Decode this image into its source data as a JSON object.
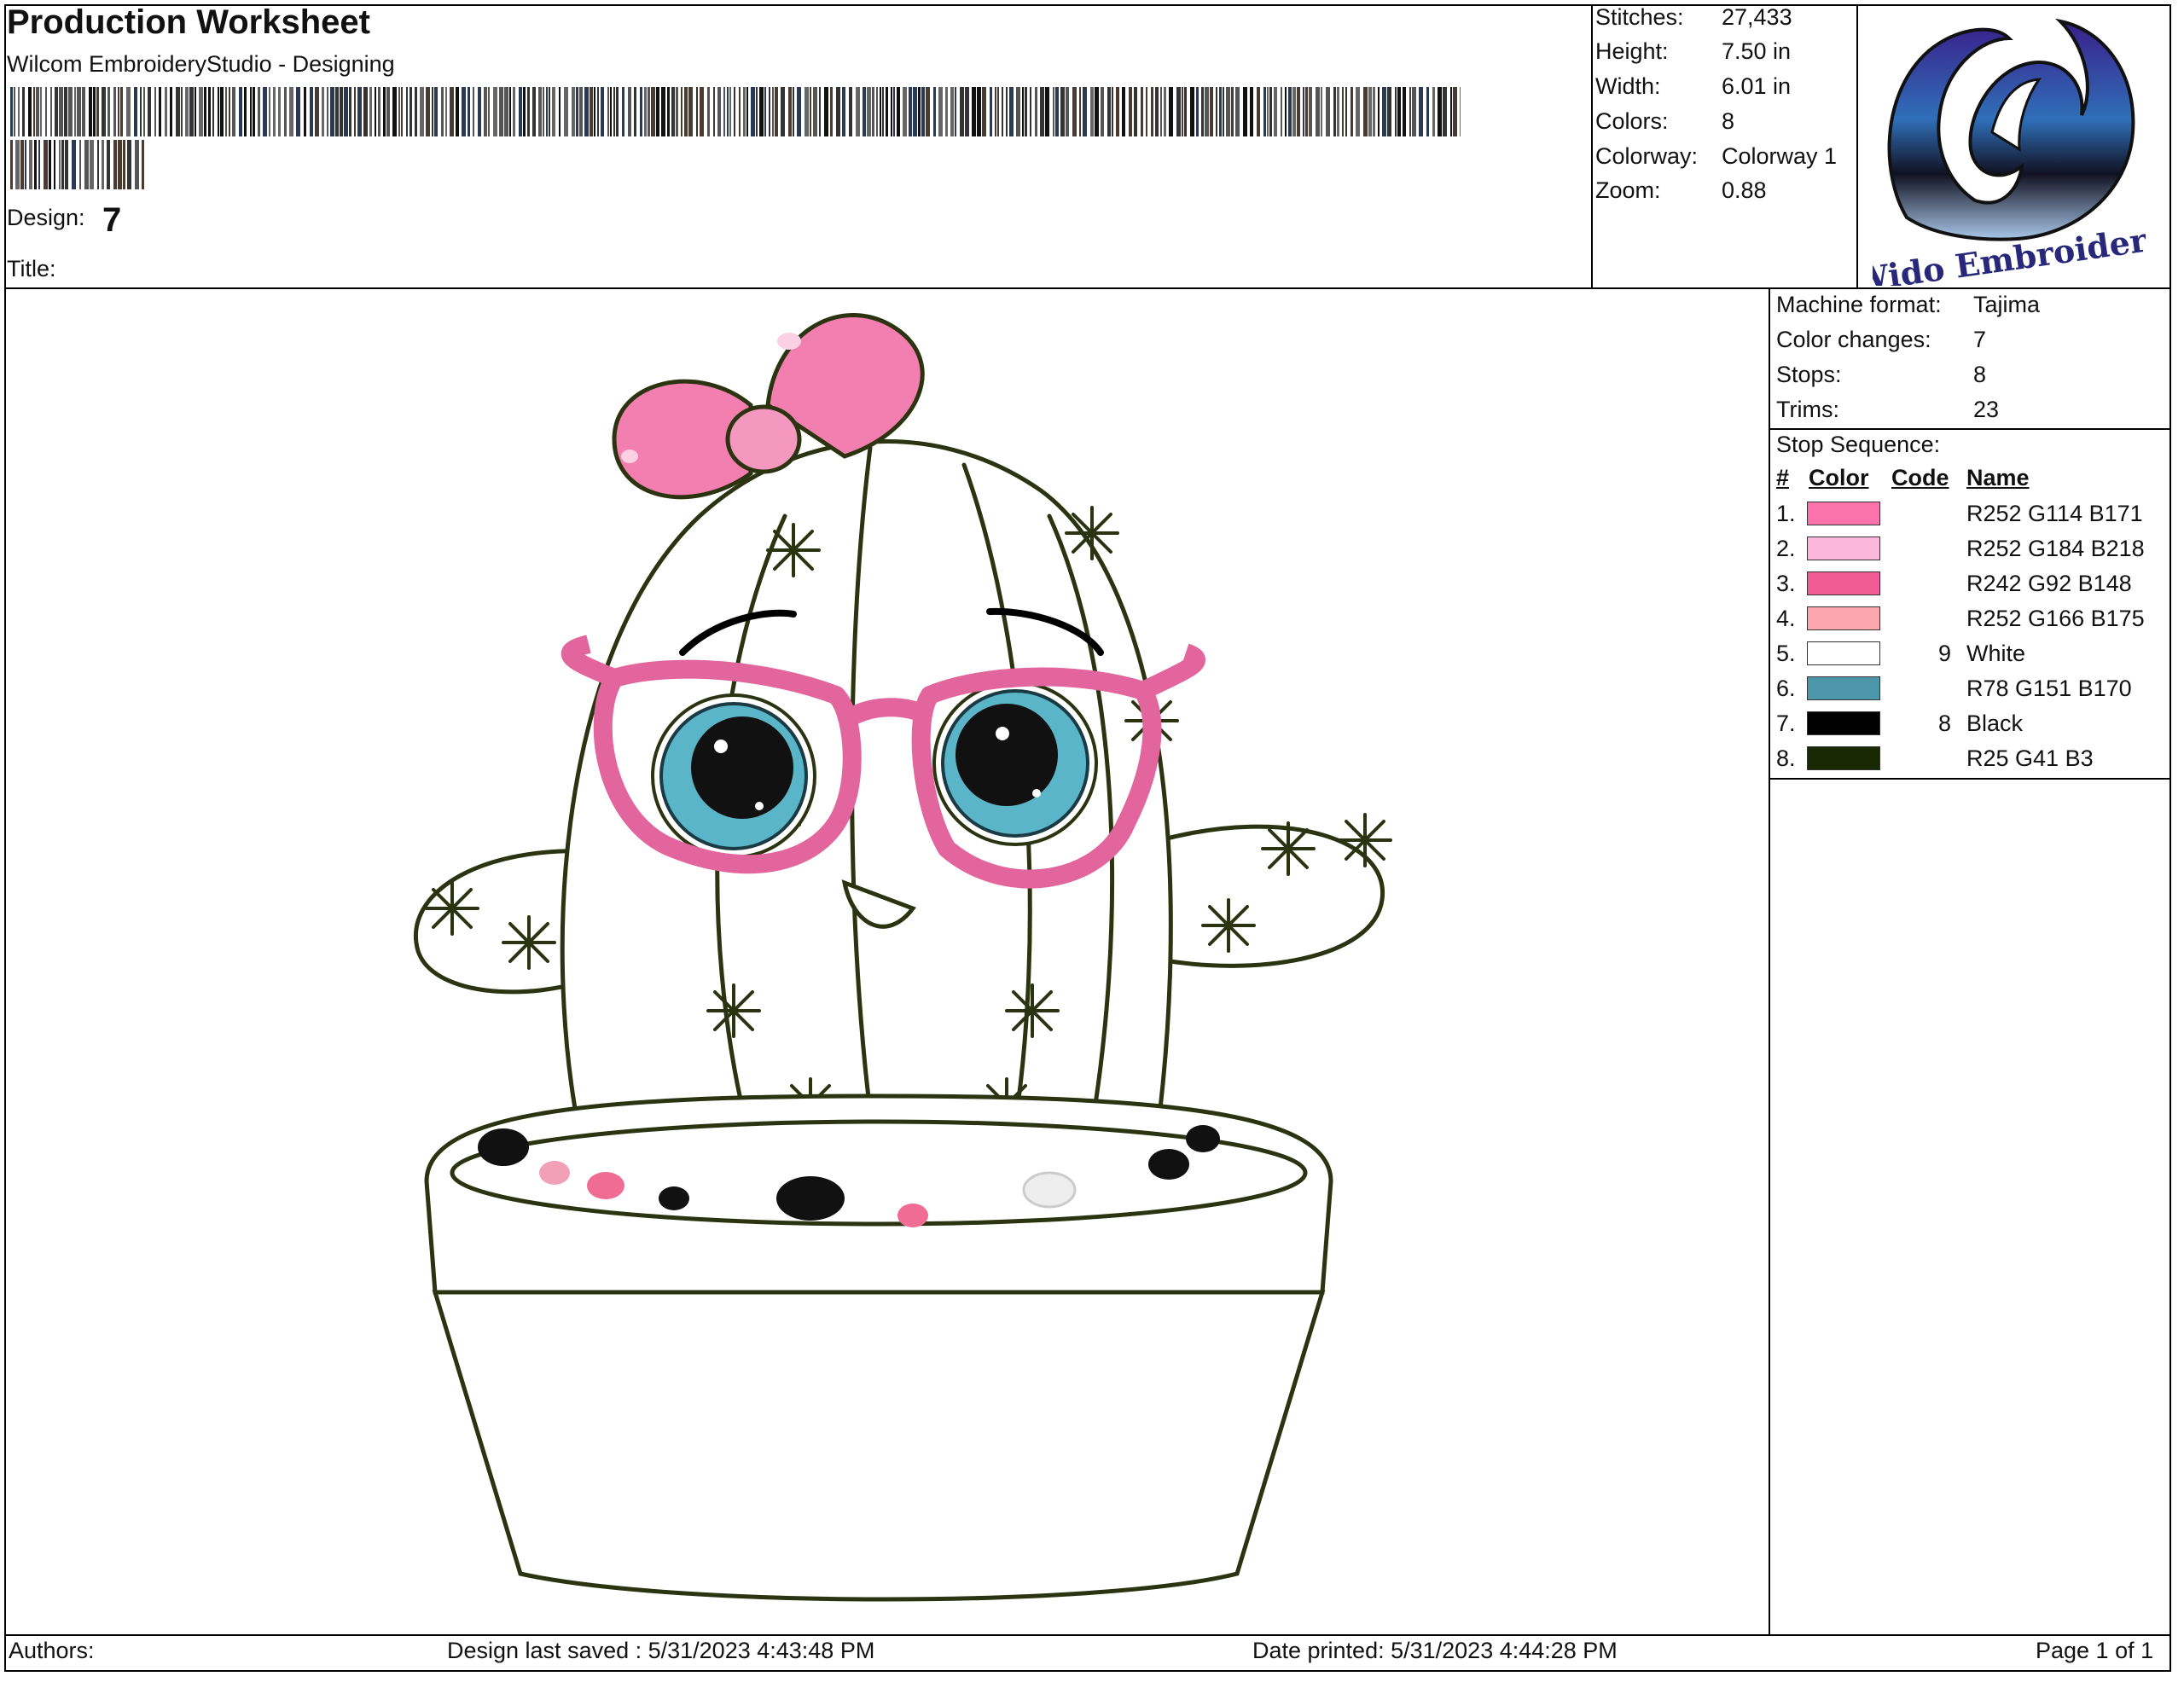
{
  "header": {
    "title": "Production Worksheet",
    "subtitle": "Wilcom EmbroideryStudio - Designing",
    "design_label": "Design:",
    "design_value": "7",
    "title_label": "Title:"
  },
  "stats": [
    {
      "label": "Stitches:",
      "value": "27,433"
    },
    {
      "label": "Height:",
      "value": "7.50 in"
    },
    {
      "label": "Width:",
      "value": "6.01 in"
    },
    {
      "label": "Colors:",
      "value": "8"
    },
    {
      "label": "Colorway:",
      "value": "Colorway 1"
    },
    {
      "label": "Zoom:",
      "value": "0.88"
    }
  ],
  "logo": {
    "text": "Wido Embroidery"
  },
  "machine": [
    {
      "label": "Machine format:",
      "value": "Tajima"
    },
    {
      "label": "Color changes:",
      "value": "7"
    },
    {
      "label": "Stops:",
      "value": "8"
    },
    {
      "label": "Trims:",
      "value": "23"
    }
  ],
  "stop_sequence": {
    "label": "Stop Sequence:",
    "headers": {
      "num": "#",
      "color": "Color",
      "code": "Code",
      "name": "Name"
    },
    "rows": [
      {
        "num": "1.",
        "color": "#fc72ab",
        "code": "",
        "name": "R252 G114 B171"
      },
      {
        "num": "2.",
        "color": "#fcb8da",
        "code": "",
        "name": "R252 G184 B218"
      },
      {
        "num": "3.",
        "color": "#f25c94",
        "code": "",
        "name": "R242 G92 B148"
      },
      {
        "num": "4.",
        "color": "#fca6af",
        "code": "",
        "name": "R252 G166 B175"
      },
      {
        "num": "5.",
        "color": "#ffffff",
        "code": "9",
        "name": "White"
      },
      {
        "num": "6.",
        "color": "#4e97aa",
        "code": "",
        "name": "R78 G151 B170"
      },
      {
        "num": "7.",
        "color": "#000000",
        "code": "8",
        "name": "Black"
      },
      {
        "num": "8.",
        "color": "#192903",
        "code": "",
        "name": "R25 G41 B3"
      }
    ]
  },
  "footer": {
    "authors": "Authors:",
    "last_saved": "Design last saved : 5/31/2023 4:43:48 PM",
    "printed": "Date printed: 5/31/2023 4:44:28 PM",
    "page": "Page 1 of 1"
  }
}
